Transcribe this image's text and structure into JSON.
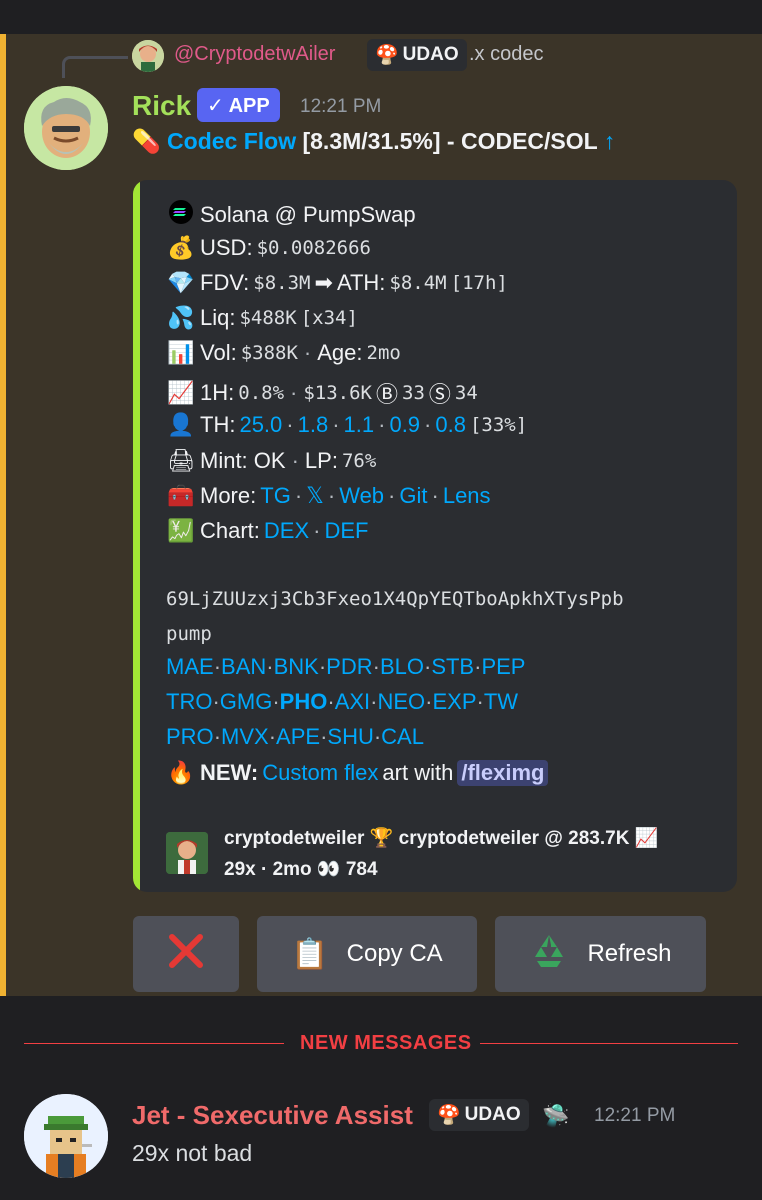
{
  "reply": {
    "author": "@CryptodetwAiler",
    "tag": "UDAO",
    "text": ".x codec"
  },
  "message": {
    "author": "Rick",
    "badge": "✓ APP",
    "time": "12:21 PM",
    "headline": {
      "emoji": "💊",
      "name": "Codec Flow",
      "stats": "[8.3M/31.5%] - CODEC/SOL",
      "arrow": "↑"
    }
  },
  "embed": {
    "chain": {
      "emoji": "◎",
      "text": "Solana @ PumpSwap"
    },
    "usd": {
      "emoji": "💰",
      "label": "USD:",
      "value": "$0.0082666"
    },
    "fdv": {
      "emoji": "💎",
      "label": "FDV:",
      "value": "$8.3M",
      "arrow": "➡",
      "ath_label": "ATH:",
      "ath_value": "$8.4M",
      "ath_age": "[17h]"
    },
    "liq": {
      "emoji": "💦",
      "label": "Liq:",
      "value": "$488K",
      "mult": "[x34]"
    },
    "vol": {
      "emoji": "📊",
      "label": "Vol:",
      "value": "$388K",
      "sep": "·",
      "age_label": "Age:",
      "age_value": "2mo"
    },
    "h1": {
      "emoji": "📈",
      "label": "1H:",
      "pct": "0.8%",
      "sep1": "·",
      "vol": "$13.6K",
      "buy_icon": "Ⓑ",
      "buys": "33",
      "sell_icon": "Ⓢ",
      "sells": "34"
    },
    "th": {
      "emoji": "👤",
      "label": "TH:",
      "holders": [
        "25.0",
        "1.8",
        "1.1",
        "0.9",
        "0.8"
      ],
      "total": "[33%]"
    },
    "mint": {
      "emoji": "🖨",
      "label": "Mint: OK",
      "sep": "·",
      "lp_label": "LP:",
      "lp_value": "76%"
    },
    "more": {
      "emoji": "🧰",
      "label": "More:",
      "links": [
        "TG",
        "𝕏",
        "Web",
        "Git",
        "Lens"
      ]
    },
    "chart": {
      "emoji": "💹",
      "label": "Chart:",
      "links": [
        "DEX",
        "DEF"
      ]
    },
    "contract": "69LjZUUzxj3Cb3Fxeo1X4QpYEQTboApkhXTysPpb",
    "contract_suffix": "pump",
    "bots_row1": [
      "MAE",
      "BAN",
      "BNK",
      "PDR",
      "BLO",
      "STB",
      "PEP"
    ],
    "bots_row2": [
      "TRO",
      "GMG",
      "PHO",
      "AXI",
      "NEO",
      "EXP",
      "TW"
    ],
    "bots_row3": [
      "PRO",
      "MVX",
      "APE",
      "SHU",
      "CAL"
    ],
    "promo": {
      "emoji": "🔥",
      "label": "NEW:",
      "link": "Custom flex",
      "text": "art with",
      "command": "/fleximg"
    },
    "footer": {
      "line1": "cryptodetweiler 🏆 cryptodetweiler @ 283.7K 📈",
      "line2": "29x · 2mo 👀 784"
    }
  },
  "buttons": {
    "close": "❌",
    "copy_icon": "📋",
    "copy": "Copy CA",
    "refresh_icon": "♻️",
    "refresh": "Refresh"
  },
  "divider": "NEW MESSAGES",
  "next_message": {
    "author": "Jet - Sexecutive Assist",
    "tag": "UDAO",
    "ufo": "🛸",
    "time": "12:21 PM",
    "text": "29x not bad"
  },
  "colors": {
    "mention_highlight": "#3b3428",
    "mention_bar": "#f0b232",
    "embed_accent": "#a3e635",
    "link": "#00a8fc",
    "app_badge": "#5865f2",
    "new_messages": "#f23f43"
  }
}
